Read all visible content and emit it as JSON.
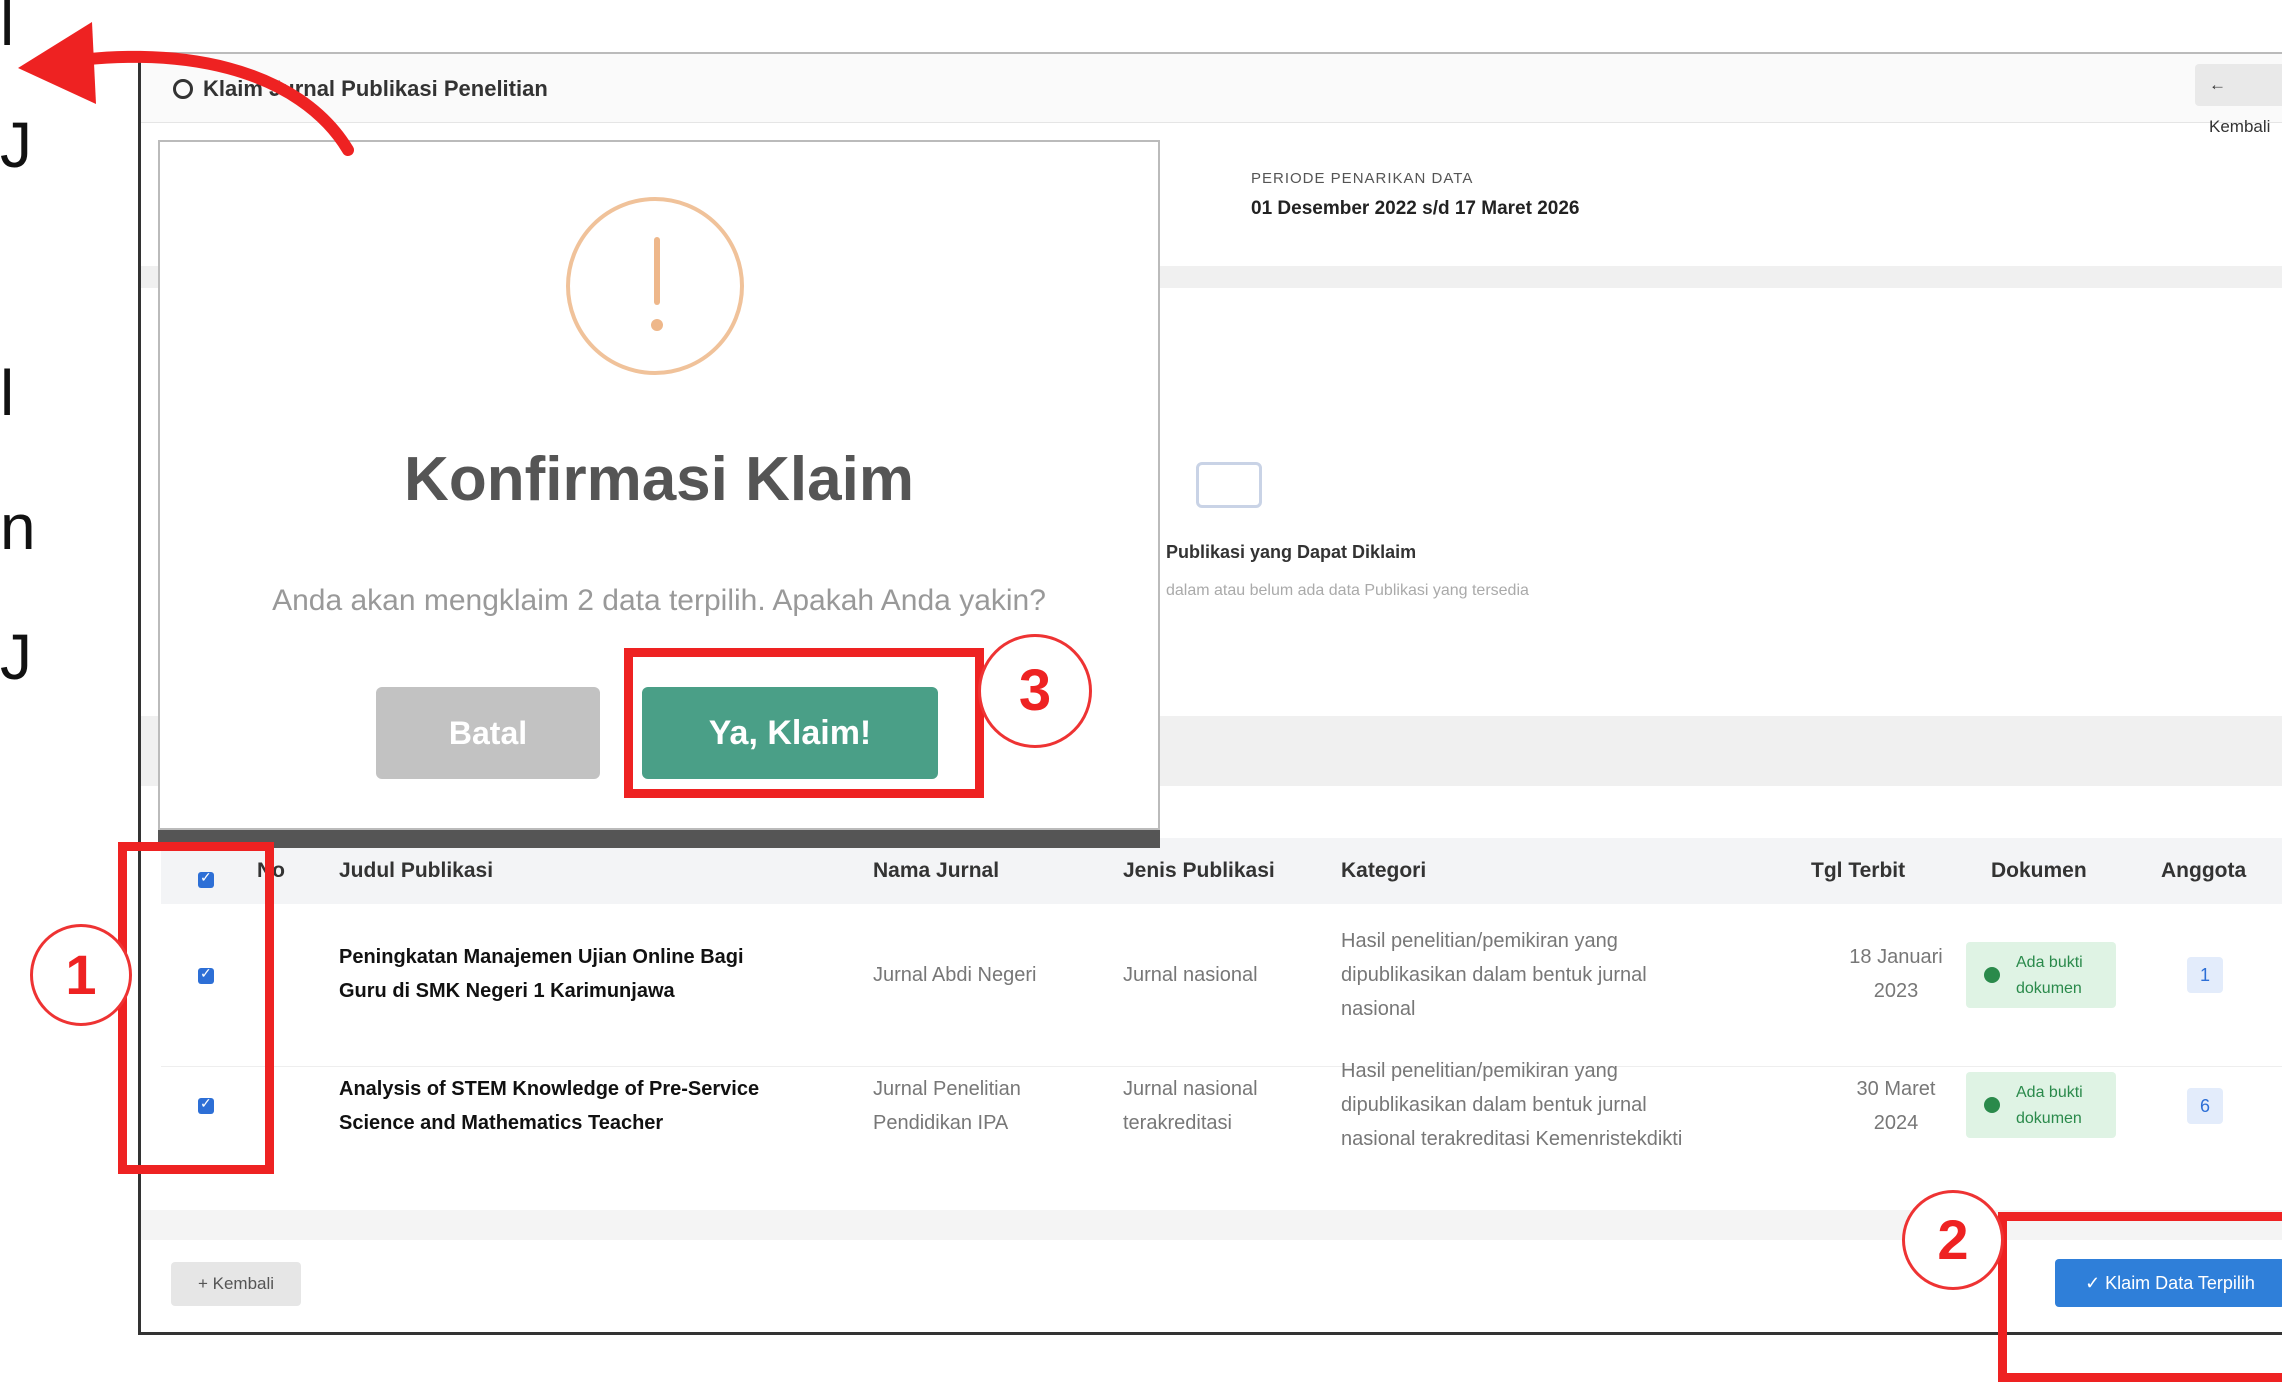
{
  "window": {
    "title": "Klaim Jurnal Publikasi Penelitian",
    "back_top_label": "Kembali"
  },
  "period": {
    "label": "PERIODE PENARIKAN DATA",
    "value": "01 Desember 2022 s/d 17 Maret 2026"
  },
  "empty_state": {
    "title": "Publikasi yang Dapat Diklaim",
    "subtitle": "dalam atau belum ada data Publikasi yang tersedia"
  },
  "modal": {
    "title": "Konfirmasi Klaim",
    "text": "Anda akan mengklaim 2 data terpilih. Apakah Anda yakin?",
    "cancel_label": "Batal",
    "confirm_label": "Ya, Klaim!"
  },
  "table": {
    "headers": [
      "No",
      "Judul Publikasi",
      "Nama Jurnal",
      "Jenis Publikasi",
      "Kategori",
      "Tgl Terbit",
      "Dokumen",
      "Anggota"
    ],
    "rows": [
      {
        "title_line1": "Peningkatan Manajemen Ujian Online Bagi",
        "title_line2": "Guru di SMK Negeri 1 Karimunjawa",
        "journal_line1": "Jurnal Abdi Negeri",
        "journal_line2": "",
        "type_line1": "Jurnal nasional",
        "type_line2": "",
        "category_line1": "Hasil penelitian/pemikiran yang",
        "category_line2": "dipublikasikan dalam bentuk jurnal",
        "category_line3": "nasional",
        "date_line1": "18 Januari",
        "date_line2": "2023",
        "doc_line1": "Ada bukti",
        "doc_line2": "dokumen",
        "member_label": "1"
      },
      {
        "title_line1": "Analysis of STEM Knowledge of Pre-Service",
        "title_line2": "Science and Mathematics Teacher",
        "journal_line1": "Jurnal Penelitian",
        "journal_line2": "Pendidikan IPA",
        "type_line1": "Jurnal nasional",
        "type_line2": "terakreditasi",
        "category_line1": "Hasil penelitian/pemikiran yang",
        "category_line2": "dipublikasikan dalam bentuk jurnal",
        "category_line3": "nasional terakreditasi Kemenristekdikti",
        "date_line1": "30 Maret",
        "date_line2": "2024",
        "doc_line1": "Ada bukti",
        "doc_line2": "dokumen",
        "member_label": "6"
      }
    ]
  },
  "footer": {
    "back_label": "Kembali",
    "claim_label": "Klaim Data Terpilih"
  },
  "annotations": {
    "step1": "1",
    "step2": "2",
    "step3": "3"
  },
  "edge_glyphs": [
    "l",
    "J",
    "l",
    "n",
    "J"
  ],
  "colors": {
    "confirm": "#4a9f87",
    "cancel": "#c2c2c2",
    "primary": "#2f7fd9",
    "annotation": "#e22222",
    "warning": "#f0c29a"
  }
}
